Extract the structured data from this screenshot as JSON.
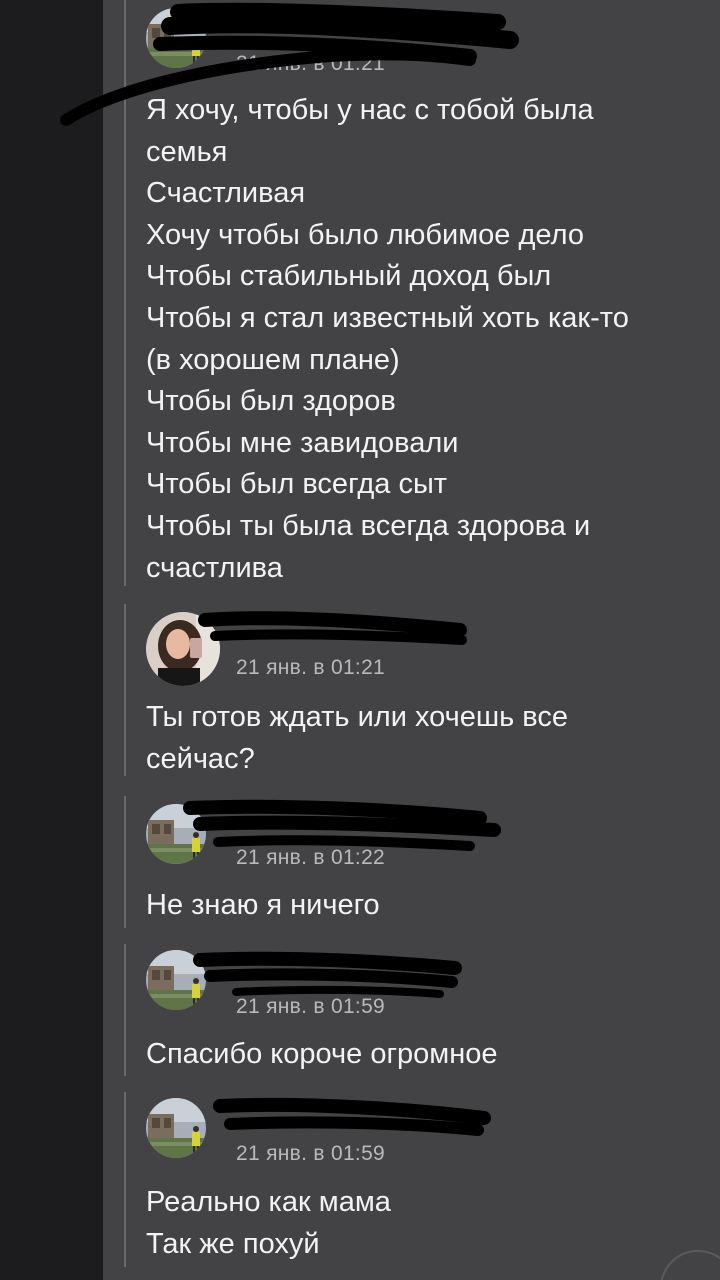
{
  "messages": [
    {
      "date": "21 янв. в 01:21",
      "lines": [
        "Я хочу, чтобы у нас с тобой была",
        "семья",
        "Счастливая",
        "Хочу чтобы было любимое дело",
        "Чтобы стабильный доход был",
        "Чтобы я стал известный хоть как-то",
        "(в хорошем плане)",
        "Чтобы был здоров",
        "Чтобы мне завидовали",
        "Чтобы был всегда сыт",
        "Чтобы ты была всегда здорова и",
        "счастлива"
      ]
    },
    {
      "date": "21 янв. в 01:21",
      "lines": [
        "Ты готов ждать или хочешь все",
        "сейчас?"
      ]
    },
    {
      "date": "21 янв. в 01:22",
      "lines": [
        "Не знаю я ничего"
      ]
    },
    {
      "date": "21 янв. в 01:59",
      "lines": [
        "Спасибо короче огромное"
      ]
    },
    {
      "date": "21 янв. в 01:59",
      "lines": [
        "Реально как мама",
        "Так же похуй"
      ]
    }
  ]
}
